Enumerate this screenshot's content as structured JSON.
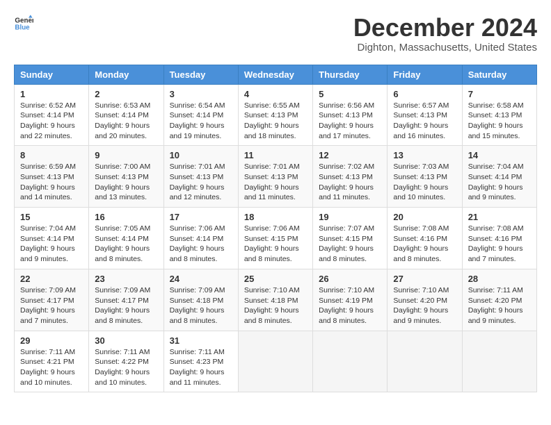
{
  "logo": {
    "line1": "General",
    "line2": "Blue"
  },
  "title": "December 2024",
  "location": "Dighton, Massachusetts, United States",
  "headers": [
    "Sunday",
    "Monday",
    "Tuesday",
    "Wednesday",
    "Thursday",
    "Friday",
    "Saturday"
  ],
  "weeks": [
    [
      {
        "day": "1",
        "sunrise": "6:52 AM",
        "sunset": "4:14 PM",
        "daylight": "9 hours and 22 minutes."
      },
      {
        "day": "2",
        "sunrise": "6:53 AM",
        "sunset": "4:14 PM",
        "daylight": "9 hours and 20 minutes."
      },
      {
        "day": "3",
        "sunrise": "6:54 AM",
        "sunset": "4:14 PM",
        "daylight": "9 hours and 19 minutes."
      },
      {
        "day": "4",
        "sunrise": "6:55 AM",
        "sunset": "4:13 PM",
        "daylight": "9 hours and 18 minutes."
      },
      {
        "day": "5",
        "sunrise": "6:56 AM",
        "sunset": "4:13 PM",
        "daylight": "9 hours and 17 minutes."
      },
      {
        "day": "6",
        "sunrise": "6:57 AM",
        "sunset": "4:13 PM",
        "daylight": "9 hours and 16 minutes."
      },
      {
        "day": "7",
        "sunrise": "6:58 AM",
        "sunset": "4:13 PM",
        "daylight": "9 hours and 15 minutes."
      }
    ],
    [
      {
        "day": "8",
        "sunrise": "6:59 AM",
        "sunset": "4:13 PM",
        "daylight": "9 hours and 14 minutes."
      },
      {
        "day": "9",
        "sunrise": "7:00 AM",
        "sunset": "4:13 PM",
        "daylight": "9 hours and 13 minutes."
      },
      {
        "day": "10",
        "sunrise": "7:01 AM",
        "sunset": "4:13 PM",
        "daylight": "9 hours and 12 minutes."
      },
      {
        "day": "11",
        "sunrise": "7:01 AM",
        "sunset": "4:13 PM",
        "daylight": "9 hours and 11 minutes."
      },
      {
        "day": "12",
        "sunrise": "7:02 AM",
        "sunset": "4:13 PM",
        "daylight": "9 hours and 11 minutes."
      },
      {
        "day": "13",
        "sunrise": "7:03 AM",
        "sunset": "4:13 PM",
        "daylight": "9 hours and 10 minutes."
      },
      {
        "day": "14",
        "sunrise": "7:04 AM",
        "sunset": "4:14 PM",
        "daylight": "9 hours and 9 minutes."
      }
    ],
    [
      {
        "day": "15",
        "sunrise": "7:04 AM",
        "sunset": "4:14 PM",
        "daylight": "9 hours and 9 minutes."
      },
      {
        "day": "16",
        "sunrise": "7:05 AM",
        "sunset": "4:14 PM",
        "daylight": "9 hours and 8 minutes."
      },
      {
        "day": "17",
        "sunrise": "7:06 AM",
        "sunset": "4:14 PM",
        "daylight": "9 hours and 8 minutes."
      },
      {
        "day": "18",
        "sunrise": "7:06 AM",
        "sunset": "4:15 PM",
        "daylight": "9 hours and 8 minutes."
      },
      {
        "day": "19",
        "sunrise": "7:07 AM",
        "sunset": "4:15 PM",
        "daylight": "9 hours and 8 minutes."
      },
      {
        "day": "20",
        "sunrise": "7:08 AM",
        "sunset": "4:16 PM",
        "daylight": "9 hours and 8 minutes."
      },
      {
        "day": "21",
        "sunrise": "7:08 AM",
        "sunset": "4:16 PM",
        "daylight": "9 hours and 7 minutes."
      }
    ],
    [
      {
        "day": "22",
        "sunrise": "7:09 AM",
        "sunset": "4:17 PM",
        "daylight": "9 hours and 7 minutes."
      },
      {
        "day": "23",
        "sunrise": "7:09 AM",
        "sunset": "4:17 PM",
        "daylight": "9 hours and 8 minutes."
      },
      {
        "day": "24",
        "sunrise": "7:09 AM",
        "sunset": "4:18 PM",
        "daylight": "9 hours and 8 minutes."
      },
      {
        "day": "25",
        "sunrise": "7:10 AM",
        "sunset": "4:18 PM",
        "daylight": "9 hours and 8 minutes."
      },
      {
        "day": "26",
        "sunrise": "7:10 AM",
        "sunset": "4:19 PM",
        "daylight": "9 hours and 8 minutes."
      },
      {
        "day": "27",
        "sunrise": "7:10 AM",
        "sunset": "4:20 PM",
        "daylight": "9 hours and 9 minutes."
      },
      {
        "day": "28",
        "sunrise": "7:11 AM",
        "sunset": "4:20 PM",
        "daylight": "9 hours and 9 minutes."
      }
    ],
    [
      {
        "day": "29",
        "sunrise": "7:11 AM",
        "sunset": "4:21 PM",
        "daylight": "9 hours and 10 minutes."
      },
      {
        "day": "30",
        "sunrise": "7:11 AM",
        "sunset": "4:22 PM",
        "daylight": "9 hours and 10 minutes."
      },
      {
        "day": "31",
        "sunrise": "7:11 AM",
        "sunset": "4:23 PM",
        "daylight": "9 hours and 11 minutes."
      },
      null,
      null,
      null,
      null
    ]
  ],
  "labels": {
    "sunrise": "Sunrise:",
    "sunset": "Sunset:",
    "daylight": "Daylight:"
  }
}
